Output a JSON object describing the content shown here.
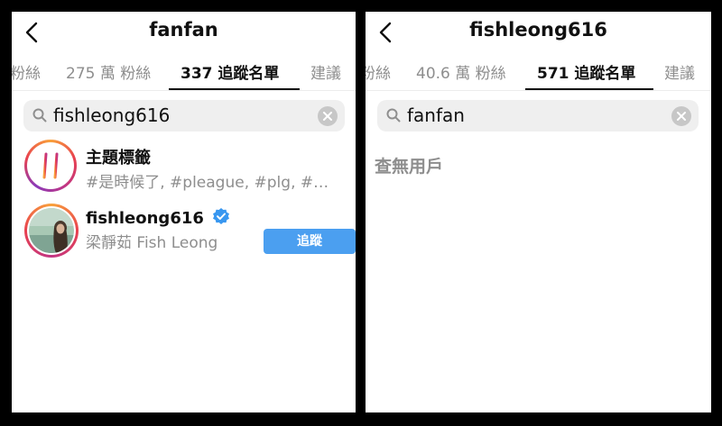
{
  "left": {
    "title": "fanfan",
    "tabs": [
      {
        "label": "粉絲"
      },
      {
        "label": "275 萬 粉絲"
      },
      {
        "label": "337 追蹤名單"
      },
      {
        "label": "建議"
      }
    ],
    "active_tab": 2,
    "search": {
      "value": "fishleong616"
    },
    "results": {
      "hashtag": {
        "title": "主題標籤",
        "subtitle": "#是時候了, #pleague, #plg, #…"
      },
      "user": {
        "username": "fishleong616",
        "fullname": "梁靜茹 Fish Leong",
        "verified": true,
        "button": "追蹤"
      }
    }
  },
  "right": {
    "title": "fishleong616",
    "tabs": [
      {
        "label": "粉絲"
      },
      {
        "label": "40.6 萬 粉絲"
      },
      {
        "label": "571 追蹤名單"
      },
      {
        "label": "建議"
      }
    ],
    "active_tab": 2,
    "search": {
      "value": "fanfan"
    },
    "empty_text": "查無用戶"
  },
  "colors": {
    "background": "#000000",
    "panel": "#ffffff",
    "follow_button": "#4b9ff0",
    "verified_badge": "#3897f0",
    "muted_text": "#8e8e8e",
    "search_bg": "#efefef"
  },
  "icons": [
    "chevron-left-icon",
    "search-icon",
    "clear-icon",
    "hashtag-icon",
    "verified-badge-icon"
  ]
}
